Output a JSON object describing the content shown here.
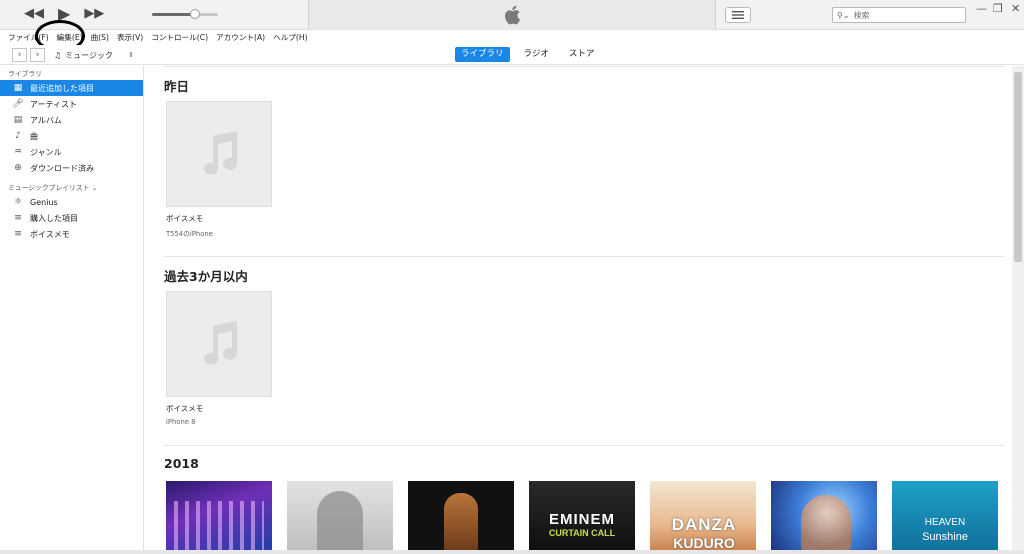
{
  "transport": {
    "rewind_icon": "rewind-icon",
    "play_icon": "play-icon",
    "forward_icon": "fast-forward-icon",
    "volume_level": 0.65
  },
  "search": {
    "placeholder": "検索"
  },
  "menu": [
    {
      "name": "menu-file",
      "label": "ファイル(F)"
    },
    {
      "name": "menu-edit",
      "label": "編集(E)"
    },
    {
      "name": "menu-song",
      "label": "曲(S)"
    },
    {
      "name": "menu-view",
      "label": "表示(V)"
    },
    {
      "name": "menu-controls",
      "label": "コントロール(C)"
    },
    {
      "name": "menu-account",
      "label": "アカウント(A)"
    },
    {
      "name": "menu-help",
      "label": "ヘルプ(H)"
    }
  ],
  "media_selector": {
    "label": "ミュージック"
  },
  "tabs": {
    "library": "ライブラリ",
    "radio": "ラジオ",
    "store": "ストア"
  },
  "sidebar": {
    "library_header": "ライブラリ",
    "library_items": [
      {
        "label": "最近追加した項目",
        "icon": "calendar-icon"
      },
      {
        "label": "アーティスト",
        "icon": "microphone-icon"
      },
      {
        "label": "アルバム",
        "icon": "album-icon"
      },
      {
        "label": "曲",
        "icon": "music-note-icon"
      },
      {
        "label": "ジャンル",
        "icon": "genre-icon"
      },
      {
        "label": "ダウンロード済み",
        "icon": "download-icon"
      }
    ],
    "playlists_header": "ミュージックプレイリスト",
    "playlist_items": [
      {
        "label": "Genius",
        "icon": "genius-icon"
      },
      {
        "label": "購入した項目",
        "icon": "purchased-playlist-icon"
      },
      {
        "label": "ボイスメモ",
        "icon": "voice-memo-playlist-icon"
      }
    ]
  },
  "sections": [
    {
      "title": "昨日",
      "item": {
        "title": "ボイスメモ",
        "subtitle": "T554のiPhone"
      }
    },
    {
      "title": "過去3か月以内",
      "item": {
        "title": "ボイスメモ",
        "subtitle": "iPhone 8"
      }
    },
    {
      "title": "2018"
    }
  ],
  "albums": [
    {
      "name": "album-cover-1",
      "text": ""
    },
    {
      "name": "album-cover-2",
      "text": ""
    },
    {
      "name": "album-cover-3",
      "text": ""
    },
    {
      "name": "album-cover-eminem",
      "text": "EMINEM",
      "text2": "CURTAIN CALL"
    },
    {
      "name": "album-cover-danza",
      "text": "DANZA",
      "text2": "KUDURO"
    },
    {
      "name": "album-cover-6",
      "text": ""
    },
    {
      "name": "album-cover-heaven",
      "text": "HEAVEN",
      "text2": "Sunshine"
    }
  ],
  "colors": {
    "accent": "#1a87e6"
  }
}
